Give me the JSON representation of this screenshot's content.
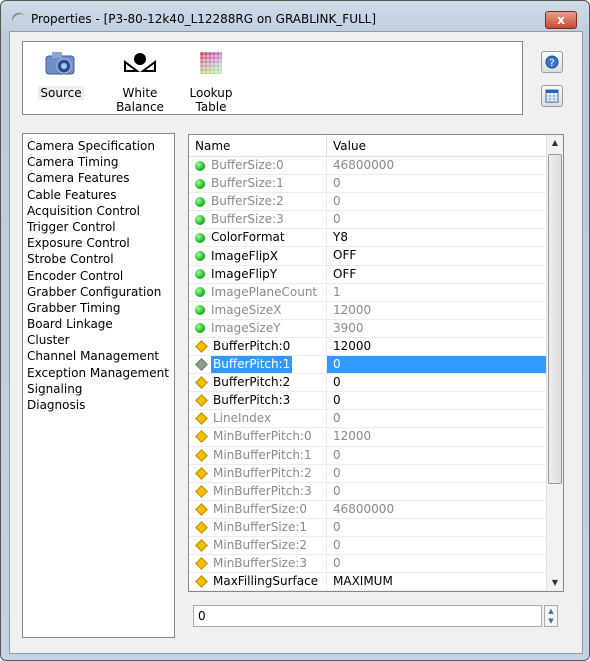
{
  "window": {
    "title": "Properties - [P3-80-12k40_L12288RG on GRABLINK_FULL]",
    "close_label": "x"
  },
  "toolbar": [
    {
      "label": "Source",
      "icon": "camera-icon"
    },
    {
      "label": "White Balance",
      "icon": "white-balance-icon"
    },
    {
      "label": "Lookup Table",
      "icon": "lookup-table-icon"
    }
  ],
  "side_buttons": [
    {
      "icon": "help-icon"
    },
    {
      "icon": "table-icon"
    }
  ],
  "categories": [
    "Camera Specification",
    "Camera Timing",
    "Camera Features",
    "Cable Features",
    "Acquisition Control",
    "Trigger Control",
    "Exposure Control",
    "Strobe Control",
    "Encoder Control",
    "Grabber Configuration",
    "Grabber Timing",
    "Board Linkage",
    "Cluster",
    "Channel Management",
    "Exception Management",
    "Signaling",
    "Diagnosis"
  ],
  "grid": {
    "headers": {
      "name": "Name",
      "value": "Value"
    },
    "rows": [
      {
        "name": "BufferSize:0",
        "value": "46800000",
        "icon": "green-dot",
        "readonly": true
      },
      {
        "name": "BufferSize:1",
        "value": "0",
        "icon": "green-dot",
        "readonly": true
      },
      {
        "name": "BufferSize:2",
        "value": "0",
        "icon": "green-dot",
        "readonly": true
      },
      {
        "name": "BufferSize:3",
        "value": "0",
        "icon": "green-dot",
        "readonly": true
      },
      {
        "name": "ColorFormat",
        "value": "Y8",
        "icon": "green-dot",
        "readonly": false
      },
      {
        "name": "ImageFlipX",
        "value": "OFF",
        "icon": "green-dot",
        "readonly": false
      },
      {
        "name": "ImageFlipY",
        "value": "OFF",
        "icon": "green-dot",
        "readonly": false
      },
      {
        "name": "ImagePlaneCount",
        "value": "1",
        "icon": "green-dot",
        "readonly": true
      },
      {
        "name": "ImageSizeX",
        "value": "12000",
        "icon": "green-dot",
        "readonly": true
      },
      {
        "name": "ImageSizeY",
        "value": "3900",
        "icon": "green-dot",
        "readonly": true
      },
      {
        "name": "BufferPitch:0",
        "value": "12000",
        "icon": "yellow-diamond",
        "readonly": false
      },
      {
        "name": "BufferPitch:1",
        "value": "0",
        "icon": "gray-diamond",
        "readonly": false,
        "selected": true
      },
      {
        "name": "BufferPitch:2",
        "value": "0",
        "icon": "yellow-diamond",
        "readonly": false
      },
      {
        "name": "BufferPitch:3",
        "value": "0",
        "icon": "yellow-diamond",
        "readonly": false
      },
      {
        "name": "LineIndex",
        "value": "0",
        "icon": "yellow-diamond",
        "readonly": true
      },
      {
        "name": "MinBufferPitch:0",
        "value": "12000",
        "icon": "yellow-diamond",
        "readonly": true
      },
      {
        "name": "MinBufferPitch:1",
        "value": "0",
        "icon": "yellow-diamond",
        "readonly": true
      },
      {
        "name": "MinBufferPitch:2",
        "value": "0",
        "icon": "yellow-diamond",
        "readonly": true
      },
      {
        "name": "MinBufferPitch:3",
        "value": "0",
        "icon": "yellow-diamond",
        "readonly": true
      },
      {
        "name": "MinBufferSize:0",
        "value": "46800000",
        "icon": "yellow-diamond",
        "readonly": true
      },
      {
        "name": "MinBufferSize:1",
        "value": "0",
        "icon": "yellow-diamond",
        "readonly": true
      },
      {
        "name": "MinBufferSize:2",
        "value": "0",
        "icon": "yellow-diamond",
        "readonly": true
      },
      {
        "name": "MinBufferSize:3",
        "value": "0",
        "icon": "yellow-diamond",
        "readonly": true
      },
      {
        "name": "MaxFillingSurface",
        "value": "MAXIMUM",
        "icon": "yellow-diamond",
        "readonly": false
      }
    ]
  },
  "editor": {
    "value": "0"
  },
  "colors": {
    "selection": "#3399ff",
    "readonly_text": "#8a8a8a"
  }
}
